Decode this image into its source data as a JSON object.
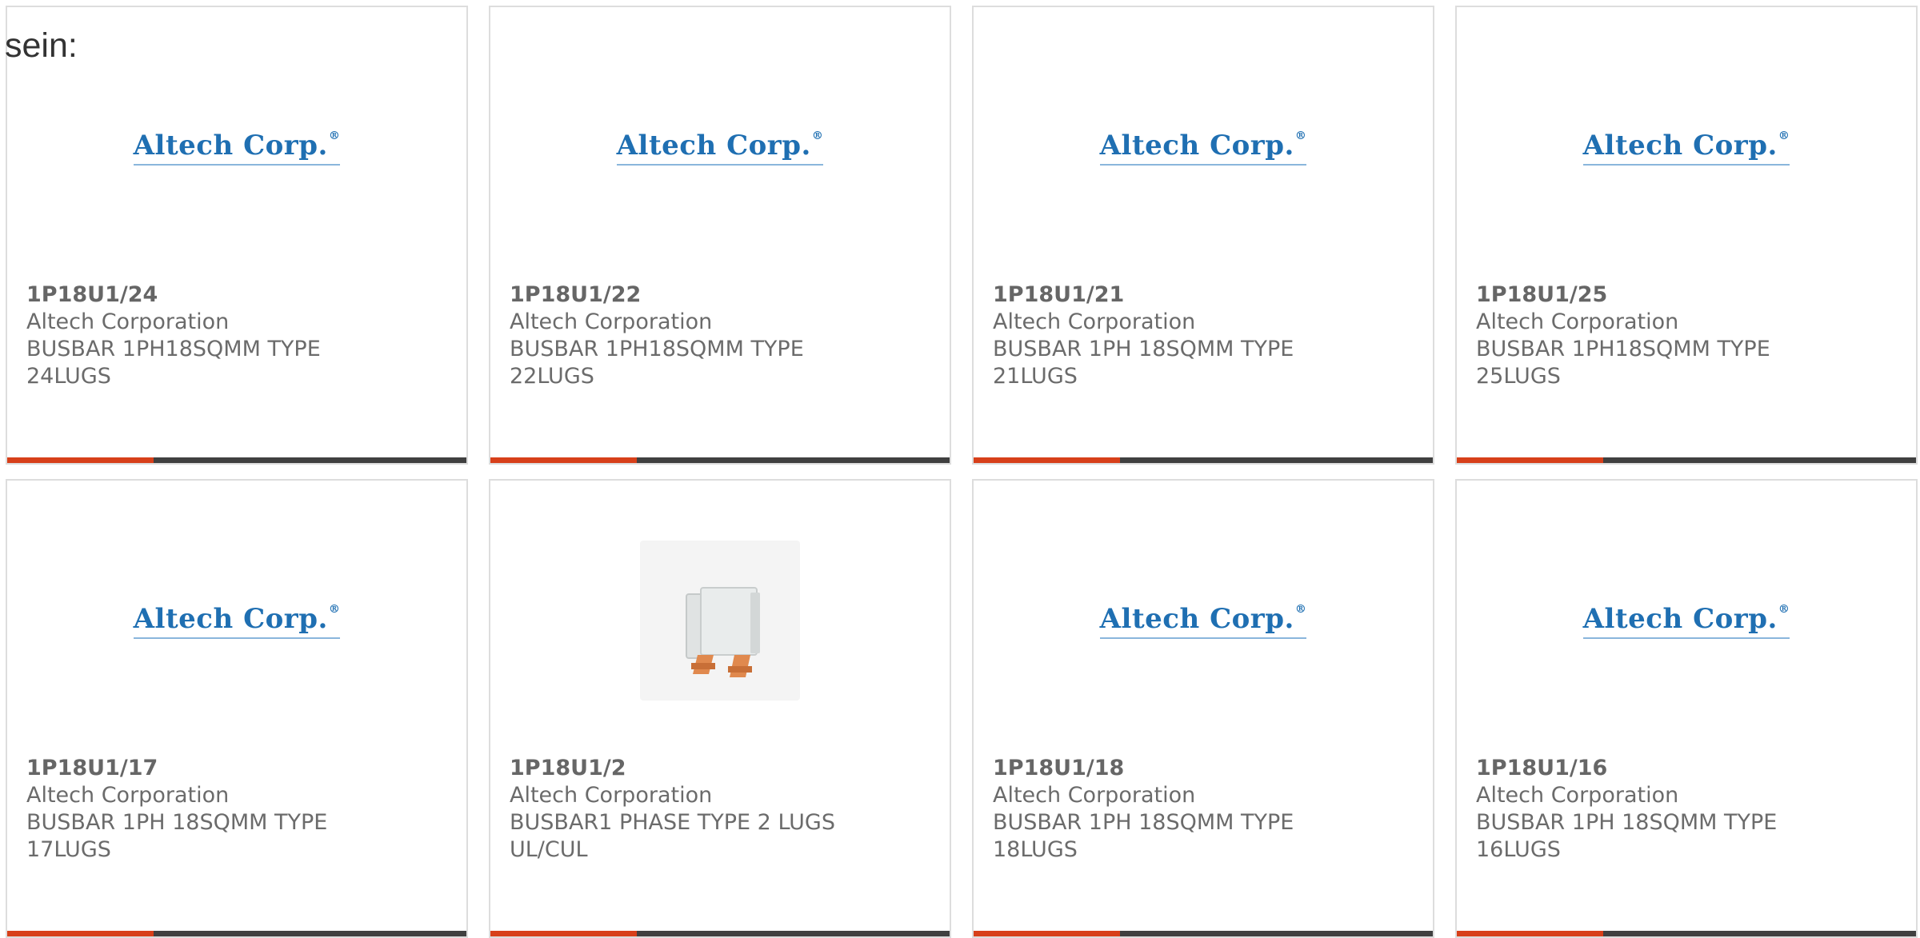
{
  "intro_text": "sein:",
  "colors": {
    "accent": "#d7401a",
    "bar": "#404040",
    "logo": "#1f6fb2"
  },
  "products": [
    {
      "part_number": "1P18U1/24",
      "manufacturer": "Altech Corporation",
      "description_line1": "BUSBAR 1PH18SQMM TYPE",
      "description_line2": "24LUGS",
      "image": "altech-logo",
      "logo_text": "Altech Corp."
    },
    {
      "part_number": "1P18U1/22",
      "manufacturer": "Altech Corporation",
      "description_line1": "BUSBAR 1PH18SQMM TYPE",
      "description_line2": "22LUGS",
      "image": "altech-logo",
      "logo_text": "Altech Corp."
    },
    {
      "part_number": "1P18U1/21",
      "manufacturer": "Altech Corporation",
      "description_line1": "BUSBAR 1PH 18SQMM TYPE",
      "description_line2": "21LUGS",
      "image": "altech-logo",
      "logo_text": "Altech Corp."
    },
    {
      "part_number": "1P18U1/25",
      "manufacturer": "Altech Corporation",
      "description_line1": "BUSBAR 1PH18SQMM TYPE",
      "description_line2": "25LUGS",
      "image": "altech-logo",
      "logo_text": "Altech Corp."
    },
    {
      "part_number": "1P18U1/17",
      "manufacturer": "Altech Corporation",
      "description_line1": "BUSBAR 1PH 18SQMM TYPE",
      "description_line2": "17LUGS",
      "image": "altech-logo",
      "logo_text": "Altech Corp."
    },
    {
      "part_number": "1P18U1/2",
      "manufacturer": "Altech Corporation",
      "description_line1": "BUSBAR1 PHASE TYPE 2 LUGS",
      "description_line2": "UL/CUL",
      "image": "busbar-photo"
    },
    {
      "part_number": "1P18U1/18",
      "manufacturer": "Altech Corporation",
      "description_line1": "BUSBAR 1PH 18SQMM TYPE",
      "description_line2": "18LUGS",
      "image": "altech-logo",
      "logo_text": "Altech Corp."
    },
    {
      "part_number": "1P18U1/16",
      "manufacturer": "Altech Corporation",
      "description_line1": "BUSBAR 1PH 18SQMM TYPE",
      "description_line2": "16LUGS",
      "image": "altech-logo",
      "logo_text": "Altech Corp."
    }
  ]
}
